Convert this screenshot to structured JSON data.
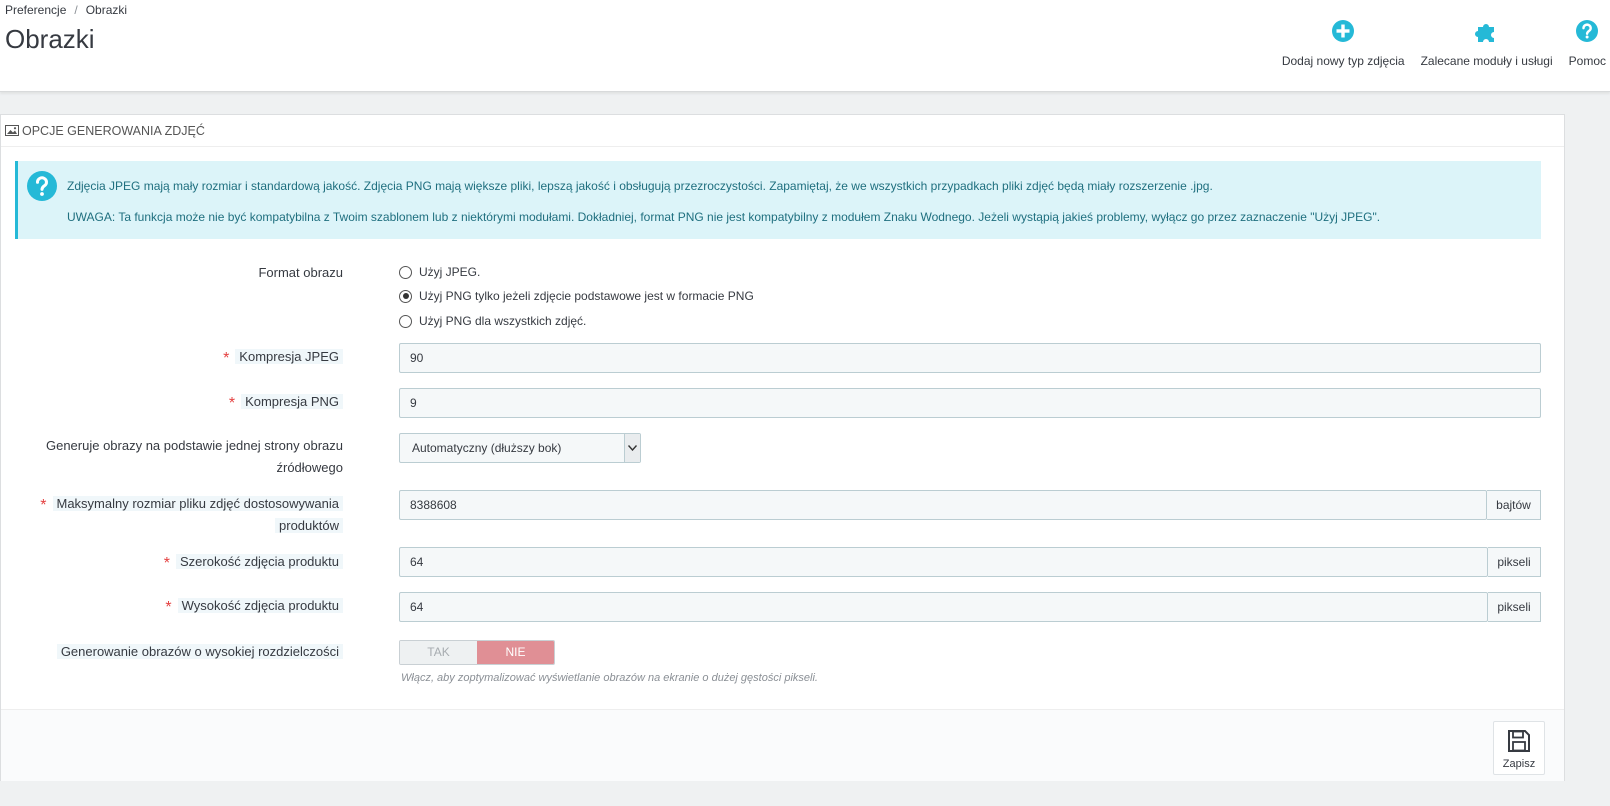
{
  "breadcrumb": {
    "parent": "Preferencje",
    "separator": "/",
    "current": "Obrazki"
  },
  "page": {
    "title": "Obrazki"
  },
  "toolbar": {
    "add_label": "Dodaj nowy typ zdjęcia",
    "modules_label": "Zalecane moduły i usługi",
    "help_label": "Pomoc",
    "accent": "#25b9d7"
  },
  "panel": {
    "heading": "OPCJE GENEROWANIA ZDJĘĆ"
  },
  "alert": {
    "line1": "Zdjęcia JPEG mają mały rozmiar i standardową jakość. Zdjęcia PNG mają większe pliki, lepszą jakość i obsługują przezroczystości. Zapamiętaj, że we wszystkich przypadkach pliki zdjęć będą miały rozszerzenie .jpg.",
    "line2": "UWAGA: Ta funkcja może nie być kompatybilna z Twoim szablonem lub z niektórymi modułami. Dokładniej, format PNG nie jest kompatybilny z modułem Znaku Wodnego. Jeżeli wystąpią jakieś problemy, wyłącz go przez zaznaczenie \"Użyj JPEG\"."
  },
  "form": {
    "format": {
      "label": "Format obrazu",
      "options": [
        {
          "label": "Użyj JPEG.",
          "selected": false
        },
        {
          "label": "Użyj PNG tylko jeżeli zdjęcie podstawowe jest w formacie PNG",
          "selected": true
        },
        {
          "label": "Użyj PNG dla wszystkich zdjęć.",
          "selected": false
        }
      ]
    },
    "jpeg_compression": {
      "label": "Kompresja JPEG",
      "value": "90"
    },
    "png_compression": {
      "label": "Kompresja PNG",
      "value": "9"
    },
    "generate_side": {
      "label_line1": "Generuje obrazy na podstawie jednej strony obrazu",
      "label_line2": "źródłowego",
      "selected": "Automatyczny (dłuższy bok)"
    },
    "max_size": {
      "label_line1": "Maksymalny rozmiar pliku zdjęć dostosowywania",
      "label_line2": "produktów",
      "value": "8388608",
      "unit": "bajtów"
    },
    "width": {
      "label": "Szerokość zdjęcia produktu",
      "value": "64",
      "unit": "pikseli"
    },
    "height": {
      "label": "Wysokość zdjęcia produktu",
      "value": "64",
      "unit": "pikseli"
    },
    "hires": {
      "label": "Generowanie obrazów o wysokiej rozdzielczości",
      "yes": "TAK",
      "no": "NIE",
      "value": "NIE",
      "help": "Włącz, aby zoptymalizować wyświetlanie obrazów na ekranie o dużej gęstości pikseli."
    }
  },
  "footer": {
    "save_label": "Zapisz"
  }
}
